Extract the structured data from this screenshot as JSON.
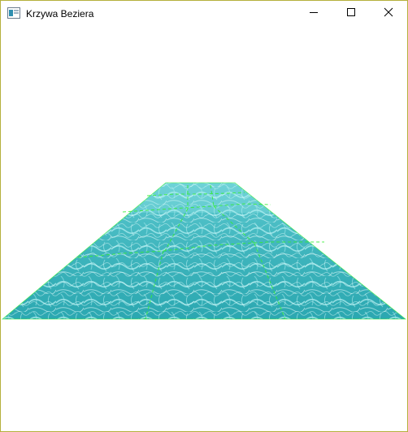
{
  "window": {
    "title": "Krzywa Beziera",
    "app_icon": "window-app-icon",
    "controls": {
      "minimize_icon": "minimize-icon",
      "maximize_icon": "maximize-icon",
      "close_icon": "close-icon"
    },
    "border_color": "#b5b03c"
  },
  "scene": {
    "surface_texture": "water",
    "grid_line_color": "#33ee33",
    "water_colors": [
      "#2aa7b0",
      "#5cc9d0",
      "#a7eef0"
    ]
  }
}
